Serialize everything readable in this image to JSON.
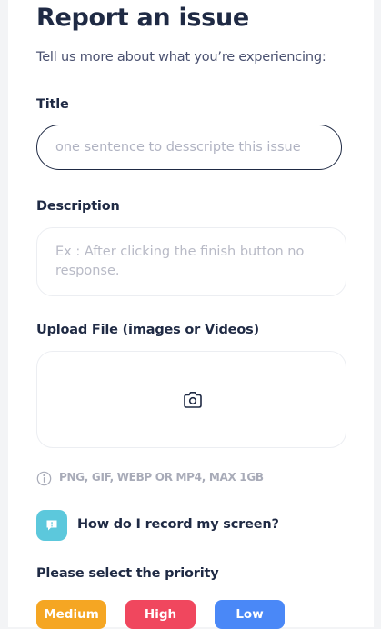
{
  "header": {
    "title": "Report an issue",
    "subtitle": "Tell us more about what you’re experiencing:"
  },
  "form": {
    "title_label": "Title",
    "title_placeholder": "one sentence to desscripte this issue",
    "description_label": "Description",
    "description_placeholder": "Ex : After clicking the finish button no response.",
    "upload_label": "Upload File (images or Videos)",
    "upload_icon": "camera-icon",
    "upload_hint": "PNG, GIF, WEBP OR MP4, MAX 1GB",
    "hint_icon": "info-icon"
  },
  "help": {
    "icon": "message-icon",
    "text": "How do I record my screen?"
  },
  "priority": {
    "label": "Please select the priority",
    "options": [
      {
        "label": "Medium",
        "color": "#f5a623"
      },
      {
        "label": "High",
        "color": "#f0475e"
      },
      {
        "label": "Low",
        "color": "#4a88f7"
      }
    ]
  },
  "colors": {
    "text_primary": "#1f2a44",
    "text_muted": "#a8abb8",
    "accent_teal": "#5cc8dc"
  }
}
